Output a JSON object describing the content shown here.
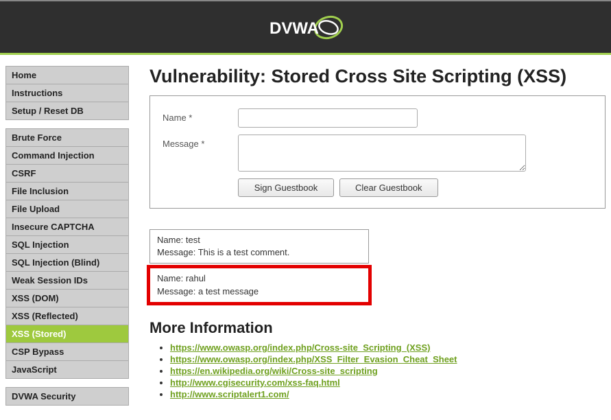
{
  "header": {
    "logo_text": "DVWA"
  },
  "sidebar": {
    "groups": [
      {
        "items": [
          {
            "label": "Home",
            "active": false
          },
          {
            "label": "Instructions",
            "active": false
          },
          {
            "label": "Setup / Reset DB",
            "active": false
          }
        ]
      },
      {
        "items": [
          {
            "label": "Brute Force",
            "active": false
          },
          {
            "label": "Command Injection",
            "active": false
          },
          {
            "label": "CSRF",
            "active": false
          },
          {
            "label": "File Inclusion",
            "active": false
          },
          {
            "label": "File Upload",
            "active": false
          },
          {
            "label": "Insecure CAPTCHA",
            "active": false
          },
          {
            "label": "SQL Injection",
            "active": false
          },
          {
            "label": "SQL Injection (Blind)",
            "active": false
          },
          {
            "label": "Weak Session IDs",
            "active": false
          },
          {
            "label": "XSS (DOM)",
            "active": false
          },
          {
            "label": "XSS (Reflected)",
            "active": false
          },
          {
            "label": "XSS (Stored)",
            "active": true
          },
          {
            "label": "CSP Bypass",
            "active": false
          },
          {
            "label": "JavaScript",
            "active": false
          }
        ]
      },
      {
        "items": [
          {
            "label": "DVWA Security",
            "active": false
          }
        ]
      }
    ]
  },
  "main": {
    "title": "Vulnerability: Stored Cross Site Scripting (XSS)",
    "form": {
      "name_label": "Name *",
      "message_label": "Message *",
      "sign_button": "Sign Guestbook",
      "clear_button": "Clear Guestbook",
      "name_value": "",
      "message_value": ""
    },
    "entries": [
      {
        "name_label": "Name:",
        "name": "test",
        "msg_label": "Message:",
        "message": "This is a test comment.",
        "highlight": false
      },
      {
        "name_label": "Name:",
        "name": "rahul",
        "msg_label": "Message:",
        "message": "a test message",
        "highlight": true
      }
    ],
    "more_info_heading": "More Information",
    "links": [
      {
        "text": "https://www.owasp.org/index.php/Cross-site_Scripting_(XSS)"
      },
      {
        "text": "https://www.owasp.org/index.php/XSS_Filter_Evasion_Cheat_Sheet"
      },
      {
        "text": "https://en.wikipedia.org/wiki/Cross-site_scripting"
      },
      {
        "text": "http://www.cgisecurity.com/xss-faq.html"
      },
      {
        "text": "http://www.scriptalert1.com/"
      }
    ]
  }
}
